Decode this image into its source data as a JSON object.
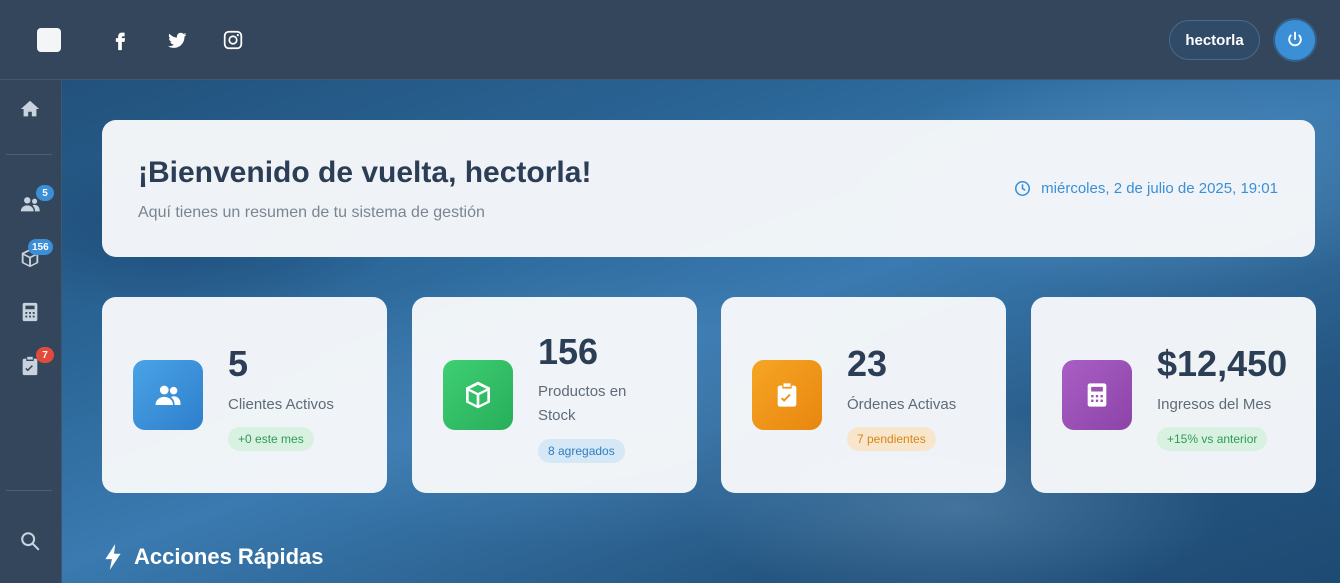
{
  "topbar": {
    "social": [
      "facebook-icon",
      "twitter-icon",
      "instagram-icon"
    ],
    "username": "hectorla"
  },
  "sidebar": {
    "items": [
      {
        "icon": "home-icon"
      },
      {
        "icon": "users-icon",
        "badge": "5"
      },
      {
        "icon": "box-icon",
        "badge": "156"
      },
      {
        "icon": "calculator-icon"
      },
      {
        "icon": "clipboard-icon",
        "badge": "7"
      }
    ],
    "bottom_icon": "search-icon"
  },
  "welcome": {
    "title": "¡Bienvenido de vuelta, hectorla!",
    "subtitle": "Aquí tienes un resumen de tu sistema de gestión",
    "datetime": "miércoles, 2 de julio de 2025, 19:01"
  },
  "stats": [
    {
      "value": "5",
      "label": "Clientes Activos",
      "note": "+0 este mes",
      "color": "#3a8fd6"
    },
    {
      "value": "156",
      "label": "Productos en Stock",
      "note": "8 agregados",
      "color": "#2fbf63"
    },
    {
      "value": "23",
      "label": "Órdenes Activas",
      "note": "7 pendientes",
      "color": "#f0941a"
    },
    {
      "value": "$12,450",
      "label": "Ingresos del Mes",
      "note": "+15% vs anterior",
      "color": "#9b4fb8"
    }
  ],
  "quick_actions": {
    "title": "Acciones Rápidas"
  }
}
